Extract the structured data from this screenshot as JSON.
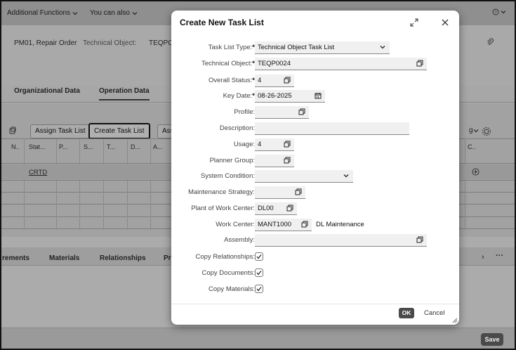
{
  "topbar": {
    "additional_functions": "Additional Functions",
    "you_can_also": "You can also"
  },
  "header": {
    "order": "PM01, Repair Order",
    "technical_object_label": "Technical Object:",
    "technical_object_value": "TEQPC"
  },
  "tabs": [
    "Organizational Data",
    "Operation Data"
  ],
  "toolbar": {
    "assign_task_list": "Assign Task List",
    "create_task_list": "Create Task List",
    "ass_partial": "Ass"
  },
  "grid": {
    "columns": [
      "N..",
      "Stat...",
      "P...",
      "S...",
      "T...",
      "D...",
      "A..."
    ],
    "right_column": "C..",
    "row1_status": "CRTD"
  },
  "bottom_tabs": [
    "rements",
    "Materials",
    "Relationships",
    "Pr"
  ],
  "footer": {
    "save": "Save"
  },
  "dialog": {
    "title": "Create New Task List",
    "fields": {
      "task_list_type": {
        "label": "Task List Type:",
        "value": "Technical Object Task List"
      },
      "technical_object": {
        "label": "Technical Object:",
        "value": "TEQP0024"
      },
      "overall_status": {
        "label": "Overall Status:",
        "value": "4"
      },
      "key_date": {
        "label": "Key Date:",
        "value": "08-26-2025"
      },
      "profile": {
        "label": "Profile:",
        "value": ""
      },
      "description": {
        "label": "Description:",
        "value": ""
      },
      "usage": {
        "label": "Usage:",
        "value": "4"
      },
      "planner_group": {
        "label": "Planner Group:",
        "value": ""
      },
      "system_condition": {
        "label": "System Condition:",
        "value": ""
      },
      "maintenance_strategy": {
        "label": "Maintenance Strategy:",
        "value": ""
      },
      "plant_of_work_center": {
        "label": "Plant of Work Center:",
        "value": "DL00"
      },
      "work_center": {
        "label": "Work Center:",
        "value": "MANT1000",
        "description": "DL Maintenance"
      },
      "assembly": {
        "label": "Assembly:",
        "value": ""
      },
      "copy_relationships": {
        "label": "Copy Relationships:",
        "checked": true
      },
      "copy_documents": {
        "label": "Copy Documents:",
        "checked": true
      },
      "copy_materials": {
        "label": "Copy Materials:",
        "checked": true
      }
    },
    "ok": "OK",
    "cancel": "Cancel"
  }
}
